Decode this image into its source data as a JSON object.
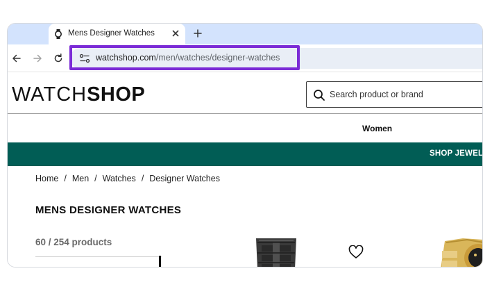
{
  "browser": {
    "tab_title": "Mens Designer Watches",
    "url_host": "watchshop.com",
    "url_path": "/men/watches/designer-watches",
    "icons": [
      "watch-favicon-icon",
      "close-icon",
      "plus-icon",
      "back-arrow-icon",
      "forward-arrow-icon",
      "reload-icon",
      "site-info-icon"
    ]
  },
  "site": {
    "logo_part1": "WATCH",
    "logo_part2": "SHOP",
    "search_placeholder": "Search product or brand",
    "nav_women": "Women",
    "promo_text": "SHOP JEWELLERY",
    "breadcrumb": [
      "Home",
      "Men",
      "Watches",
      "Designer Watches"
    ],
    "breadcrumb_separator": "/",
    "page_title": "MENS DESIGNER WATCHES",
    "product_count": "60 / 254 products"
  },
  "colors": {
    "tabstrip": "#d3e3fd",
    "omnibox": "#e9eef6",
    "highlight": "#7b2bd6",
    "promo_bar": "#015d55"
  }
}
